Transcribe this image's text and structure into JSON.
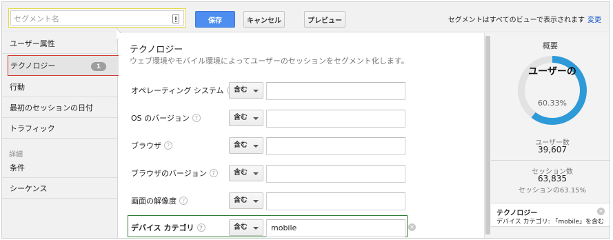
{
  "header": {
    "segment_name_placeholder": "セグメント名",
    "save_label": "保存",
    "cancel_label": "キャンセル",
    "preview_label": "プレビュー",
    "visibility_note": "セグメントはすべてのビューで表示されます",
    "change_link": "変更"
  },
  "sidebar": {
    "items": [
      {
        "label": "ユーザー属性"
      },
      {
        "label": "テクノロジー",
        "badge": "1",
        "active": true
      },
      {
        "label": "行動"
      },
      {
        "label": "最初のセッションの日付"
      },
      {
        "label": "トラフィック"
      }
    ],
    "section_label": "詳細",
    "advanced_items": [
      {
        "label": "条件"
      },
      {
        "label": "シーケンス"
      }
    ]
  },
  "main": {
    "title": "テクノロジー",
    "description": "ウェブ環境やモバイル環境によってユーザーのセッションをセグメント化します。",
    "help_glyph": "?",
    "rows": [
      {
        "label": "オペレーティング システム",
        "operator": "含む",
        "value": ""
      },
      {
        "label": "OS のバージョン",
        "operator": "含む",
        "value": ""
      },
      {
        "label": "ブラウザ",
        "operator": "含む",
        "value": ""
      },
      {
        "label": "ブラウザのバージョン",
        "operator": "含む",
        "value": ""
      },
      {
        "label": "画面の解像度",
        "operator": "含む",
        "value": ""
      },
      {
        "label": "デバイス カテゴリ",
        "operator": "含む",
        "value": "mobile",
        "highlighted": true
      }
    ]
  },
  "summary": {
    "title": "概要",
    "donut_label": "ユーザーの",
    "donut_percent": "60.33%",
    "donut_fraction": 0.6033,
    "users_label": "ユーザー数",
    "users_value": "39,607",
    "sessions_label": "セッション数",
    "sessions_value": "63,835",
    "sessions_share": "セッションの63.15%",
    "condition_title": "テクノロジー",
    "condition_detail": "デバイス カテゴリ: 「mobile」を含む"
  },
  "colors": {
    "accent": "#4d8ef0",
    "donut_fill": "#2e9ad8",
    "donut_track": "#e2e2e2",
    "highlight_border": "#2e7d32",
    "active_border": "#d23b32"
  }
}
